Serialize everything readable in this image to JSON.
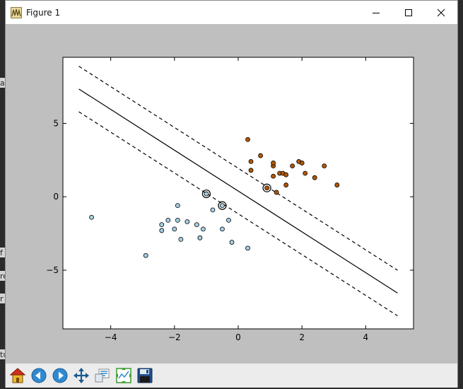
{
  "window": {
    "title": "Figure 1",
    "controls": [
      "minimize",
      "maximize",
      "close"
    ]
  },
  "background_fragments": [
    "a",
    "f",
    "re",
    "r",
    "tu"
  ],
  "toolbar": {
    "buttons": [
      {
        "name": "home",
        "icon": "home-icon",
        "tooltip": "Reset original view"
      },
      {
        "name": "back",
        "icon": "back-arrow-icon",
        "tooltip": "Back to previous view"
      },
      {
        "name": "forward",
        "icon": "forward-arrow-icon",
        "tooltip": "Forward to next view"
      },
      {
        "name": "pan",
        "icon": "pan-move-icon",
        "tooltip": "Pan axes"
      },
      {
        "name": "zoom",
        "icon": "zoom-rect-icon",
        "tooltip": "Zoom to rectangle"
      },
      {
        "name": "subplots",
        "icon": "subplots-config-icon",
        "tooltip": "Configure subplots"
      },
      {
        "name": "save",
        "icon": "floppy-save-icon",
        "tooltip": "Save the figure"
      }
    ]
  },
  "chart_data": {
    "type": "scatter",
    "title": "",
    "xlabel": "",
    "ylabel": "",
    "xlim": [
      -5.5,
      5.5
    ],
    "ylim": [
      -9,
      9.5
    ],
    "xticks": [
      -4,
      -2,
      0,
      2,
      4
    ],
    "yticks": [
      5,
      0,
      -5
    ],
    "xtick_labels": [
      "−4",
      "−2",
      "0",
      "2",
      "4"
    ],
    "ytick_labels": [
      "5",
      "0",
      "−5"
    ],
    "grid": false,
    "colors": {
      "class0": "#a6cee3",
      "class1": "#b35806",
      "edge": "#000000",
      "frame": "#000000"
    },
    "series": [
      {
        "points": [
          [
            -4.6,
            -1.4
          ],
          [
            -2.9,
            -4.0
          ],
          [
            -2.4,
            -1.9
          ],
          [
            -2.4,
            -2.3
          ],
          [
            -2.2,
            -1.6
          ],
          [
            -2.0,
            -2.2
          ],
          [
            -1.9,
            -0.6
          ],
          [
            -1.9,
            -1.6
          ],
          [
            -1.8,
            -2.9
          ],
          [
            -1.6,
            -1.7
          ],
          [
            -1.3,
            -1.9
          ],
          [
            -1.2,
            -2.8
          ],
          [
            -1.1,
            -2.2
          ],
          [
            -1.0,
            0.2
          ],
          [
            -0.8,
            -0.9
          ],
          [
            -0.5,
            -2.2
          ],
          [
            -0.5,
            -0.6
          ],
          [
            -0.3,
            -1.6
          ],
          [
            -0.2,
            -3.1
          ],
          [
            0.3,
            -3.5
          ]
        ]
      },
      {
        "points": [
          [
            0.3,
            3.9
          ],
          [
            0.4,
            2.4
          ],
          [
            0.4,
            1.8
          ],
          [
            0.7,
            2.8
          ],
          [
            0.9,
            0.6
          ],
          [
            1.1,
            2.1
          ],
          [
            1.1,
            1.4
          ],
          [
            1.1,
            2.3
          ],
          [
            1.2,
            0.3
          ],
          [
            1.3,
            1.6
          ],
          [
            1.4,
            1.6
          ],
          [
            1.5,
            0.8
          ],
          [
            1.5,
            1.5
          ],
          [
            1.7,
            2.1
          ],
          [
            1.9,
            2.4
          ],
          [
            2.0,
            2.3
          ],
          [
            2.1,
            1.6
          ],
          [
            2.4,
            1.3
          ],
          [
            2.7,
            2.1
          ],
          [
            3.1,
            0.8
          ]
        ]
      }
    ],
    "support_vectors": [
      [
        -1.0,
        0.2
      ],
      [
        -0.5,
        -0.6
      ],
      [
        0.9,
        0.6
      ]
    ],
    "decision_function": {
      "slope": -1.39,
      "intercept": 0.39
    },
    "margin_offsets": [
      1.55,
      -1.55
    ],
    "line_x_range": [
      -5,
      5
    ],
    "line_styles": {
      "decision": "solid",
      "margin": "dashed"
    }
  }
}
